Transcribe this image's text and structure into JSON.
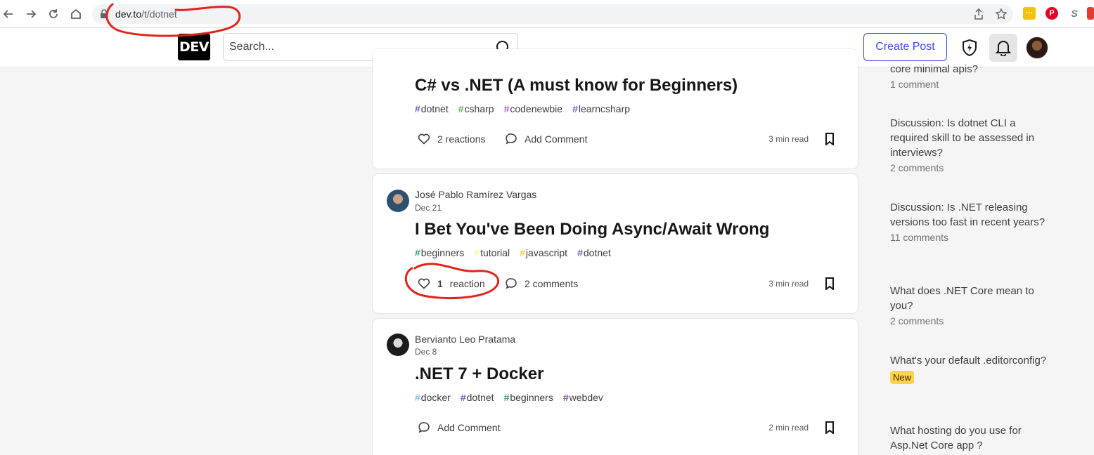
{
  "browser": {
    "url_domain": "dev.to",
    "url_path": "/t/dotnet"
  },
  "header": {
    "logo_text": "DEV",
    "search_placeholder": "Search...",
    "create_post_label": "Create Post"
  },
  "posts": [
    {
      "title": "C# vs .NET (A must know for Beginners)",
      "tags": [
        {
          "hash": "#",
          "name": "dotnet",
          "color": "#4b2aa8"
        },
        {
          "hash": "#",
          "name": "csharp",
          "color": "#2a9d2a"
        },
        {
          "hash": "#",
          "name": "codenewbie",
          "color": "#9b28e0"
        },
        {
          "hash": "#",
          "name": "learncsharp",
          "color": "#4b2aa8"
        }
      ],
      "reactions_label": "2 reactions",
      "comments_label": "Add Comment",
      "read_time": "3 min read"
    },
    {
      "author": "José Pablo Ramírez Vargas",
      "date": "Dec 21",
      "title": "I Bet You've Been Doing Async/Await Wrong",
      "tags": [
        {
          "hash": "#",
          "name": "beginners",
          "color": "#008335"
        },
        {
          "hash": "#",
          "name": "tutorial",
          "color": "#fef08a"
        },
        {
          "hash": "#",
          "name": "javascript",
          "color": "#e8c400"
        },
        {
          "hash": "#",
          "name": "dotnet",
          "color": "#4b2aa8"
        }
      ],
      "reactions_count": "1",
      "reactions_label": "reaction",
      "comments_label": "2 comments",
      "read_time": "3 min read"
    },
    {
      "author": "Bervianto Leo Pratama",
      "date": "Dec 8",
      "title": ".NET 7 + Docker",
      "tags": [
        {
          "hash": "#",
          "name": "docker",
          "color": "#66b5e8"
        },
        {
          "hash": "#",
          "name": "dotnet",
          "color": "#4b2aa8"
        },
        {
          "hash": "#",
          "name": "beginners",
          "color": "#008335"
        },
        {
          "hash": "#",
          "name": "webdev",
          "color": "#562765"
        }
      ],
      "comments_label": "Add Comment",
      "read_time": "2 min read"
    }
  ],
  "sidebar": {
    "items": [
      {
        "title": "core minimal apis?",
        "meta": "1 comment"
      },
      {
        "title": "Discussion: Is dotnet CLI a required skill to be assessed in interviews?",
        "meta": "2 comments"
      },
      {
        "title": "Discussion: Is .NET releasing versions too fast in recent years?",
        "meta": "11 comments"
      },
      {
        "title": "What does .NET Core mean to you?",
        "meta": "2 comments"
      },
      {
        "title": "What's your default .editorconfig?",
        "badge": "New"
      },
      {
        "title": "What hosting do you use for Asp.Net Core app ?"
      }
    ]
  }
}
